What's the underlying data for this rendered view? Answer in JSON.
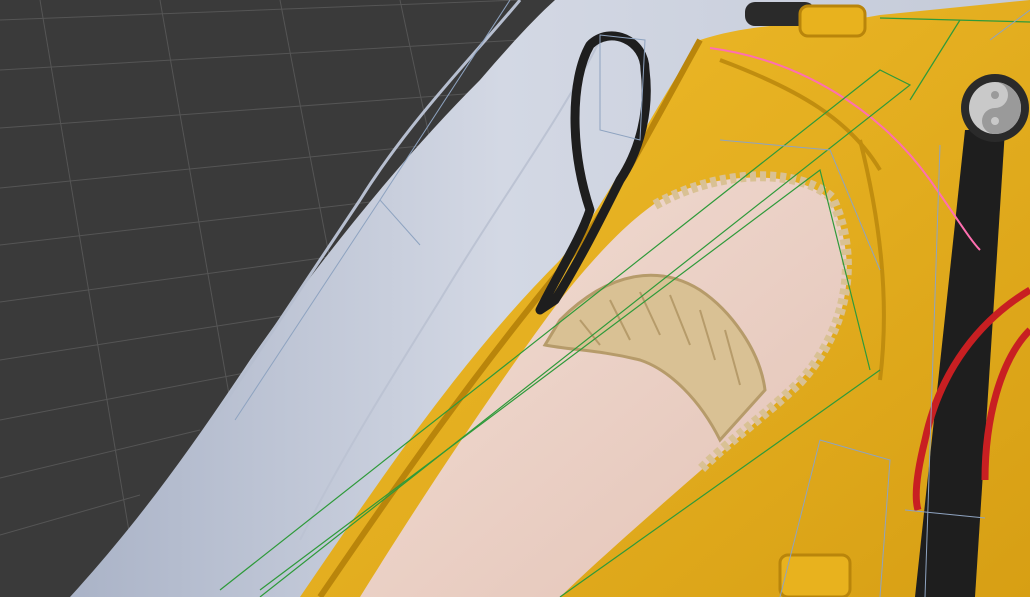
{
  "viewport": {
    "background": "#3a3a3a",
    "grid_line_color": "#555555",
    "wireframe_color": "#6b86a8",
    "bone_color": "#2e9a3a",
    "selection_color": "#ff6fb0"
  },
  "model": {
    "sleeve_color": "#d3d8e4",
    "sleeve_shadow_color": "#aab3c7",
    "vest_color": "#e8b21e",
    "vest_dark_color": "#b9850b",
    "trim_color": "#d9c194",
    "skin_color": "#edd6cc",
    "strap_color": "#1e1e1e",
    "cord_color": "#c81f22",
    "emblem_color": "#c9c9c9",
    "emblem_icon": "yin-yang-icon"
  }
}
